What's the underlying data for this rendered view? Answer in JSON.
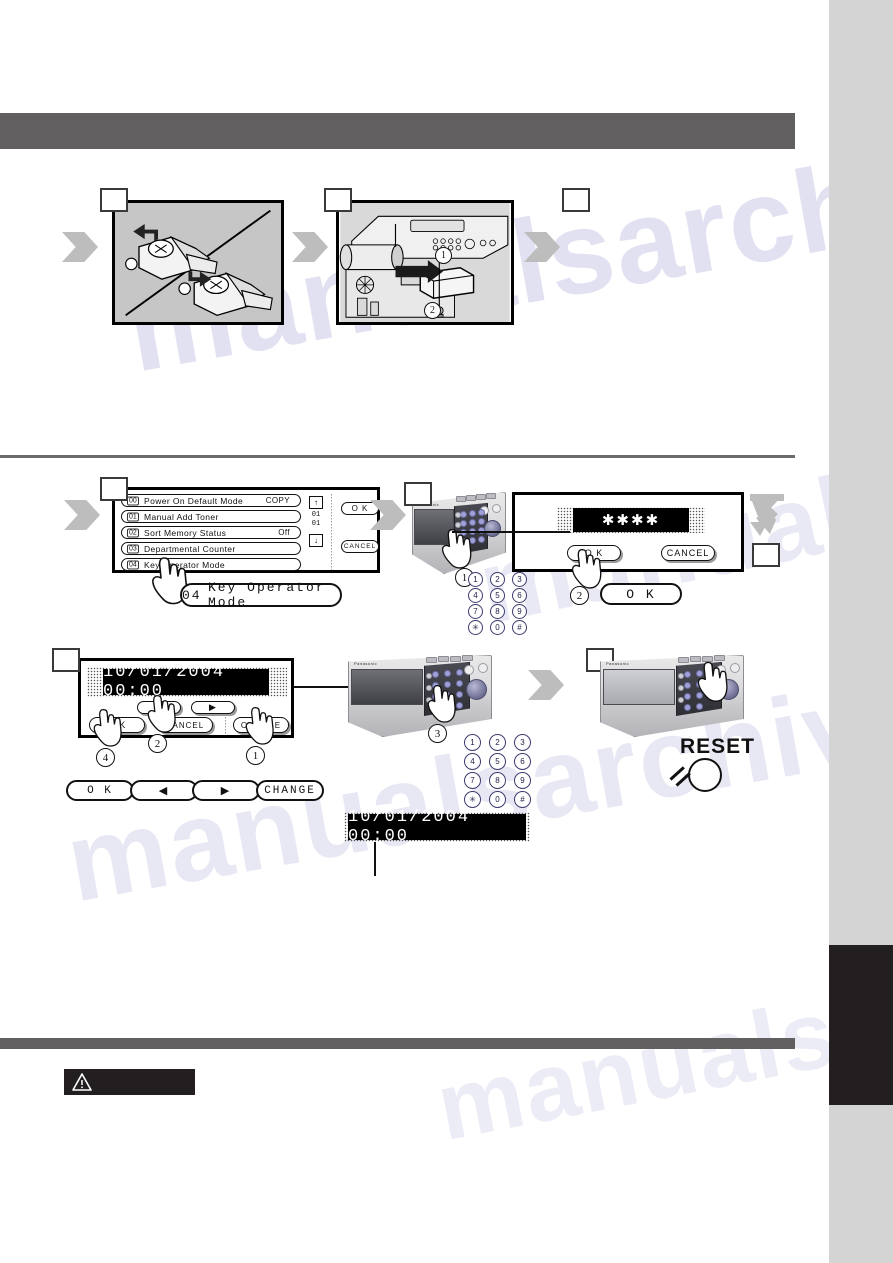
{
  "page": {
    "background_color": "#ffffff",
    "sidebar_color": "#d4d4d4",
    "tab_color": "#231f20",
    "header_bar_color": "#615f60",
    "rule_color": "#6c6a6b",
    "watermark_text": "manualsarchive.com"
  },
  "illustrations": {
    "battery_panel": {
      "name": "lithium-battery-orientation",
      "step_label": "",
      "caption": ""
    },
    "machine_panel": {
      "name": "battery-holder-removal",
      "step_label": "",
      "marker_one": "1",
      "marker_two": "2"
    }
  },
  "step_markers": [
    "",
    "",
    "",
    "",
    "",
    "",
    "",
    "",
    ""
  ],
  "lcd_menu": {
    "name": "function-mode-list",
    "rows": [
      {
        "index": "00",
        "label": "Power On Default Mode",
        "value": "COPY"
      },
      {
        "index": "01",
        "label": "Manual Add Toner",
        "value": ""
      },
      {
        "index": "02",
        "label": "Sort Memory Status",
        "value": "Off"
      },
      {
        "index": "03",
        "label": "Departmental Counter",
        "value": ""
      },
      {
        "index": "04",
        "label": "Key Operator Mode",
        "value": ""
      }
    ],
    "scroll": {
      "up_glyph": "↑",
      "down_glyph": "↓",
      "current_page": "01",
      "total_pages": "01"
    },
    "ok_label": "O K",
    "cancel_label": "CANCEL",
    "callout": {
      "index": "04",
      "label": "Key Operator Mode"
    }
  },
  "password_panel": {
    "name": "key-operator-password-entry",
    "readout": "✱✱✱✱",
    "ok_label": "O K",
    "cancel_label": "CANCEL",
    "callout_ok_label": "O K",
    "touch_order_keypad": "1",
    "touch_order_ok": "2"
  },
  "datetime_panel": {
    "name": "date-time-setting",
    "readout": "10/01/2004  00:00",
    "left_arrow_glyph": "◀",
    "right_arrow_glyph": "▶",
    "ok_label": "O K",
    "cancel_label": "CANCEL",
    "change_label": "CHANGE",
    "touch_order_change": "1",
    "touch_order_left": "2",
    "touch_order_keypad": "3",
    "touch_order_ok": "4",
    "callouts": {
      "ok_label": "O K",
      "left_label": "◀",
      "right_label": "▶",
      "change_label": "CHANGE"
    },
    "result_readout": "10/01/2004  00:00"
  },
  "keypad": {
    "name": "numeric-keypad",
    "keys": [
      "1",
      "2",
      "3",
      "4",
      "5",
      "6",
      "7",
      "8",
      "9",
      "✱",
      "0",
      "#"
    ]
  },
  "reset": {
    "label": "RESET",
    "name": "reset-key-callout"
  },
  "caution": {
    "name": "caution-notice",
    "icon": "warning-triangle-icon",
    "text": ""
  }
}
